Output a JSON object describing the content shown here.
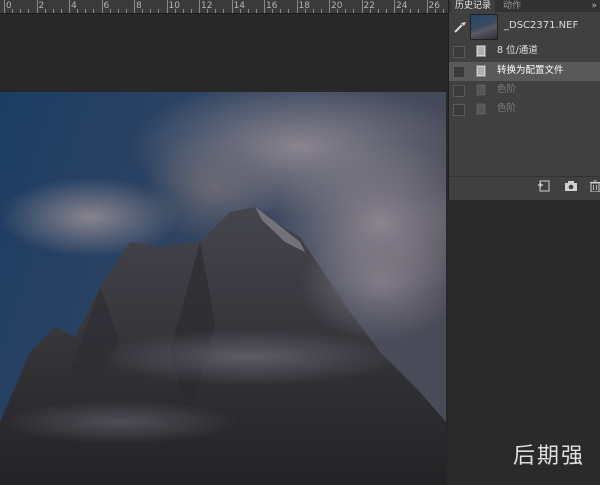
{
  "ruler": {
    "labels": [
      "0",
      "2",
      "4",
      "6",
      "8",
      "10",
      "12",
      "14",
      "16",
      "18",
      "20",
      "22",
      "24",
      "26",
      "28"
    ]
  },
  "history_panel": {
    "tabs": [
      {
        "label": "历史记录",
        "active": true
      },
      {
        "label": "动作",
        "active": false
      }
    ],
    "menu_glyph": "»",
    "snapshot": {
      "label": "_DSC2371.NEF"
    },
    "steps": [
      {
        "label": "8 位/通道",
        "state": "normal"
      },
      {
        "label": "转换为配置文件",
        "state": "active"
      },
      {
        "label": "色阶",
        "state": "dimmed"
      },
      {
        "label": "色阶",
        "state": "dimmed"
      }
    ],
    "footer_icons": [
      "new-document-from-state-icon",
      "camera-icon",
      "trash-icon"
    ]
  },
  "colors": {
    "panel": "#404040",
    "active_row": "#595959",
    "sky": "#1d4066",
    "workspace": "#282828"
  },
  "watermark": "后期强"
}
